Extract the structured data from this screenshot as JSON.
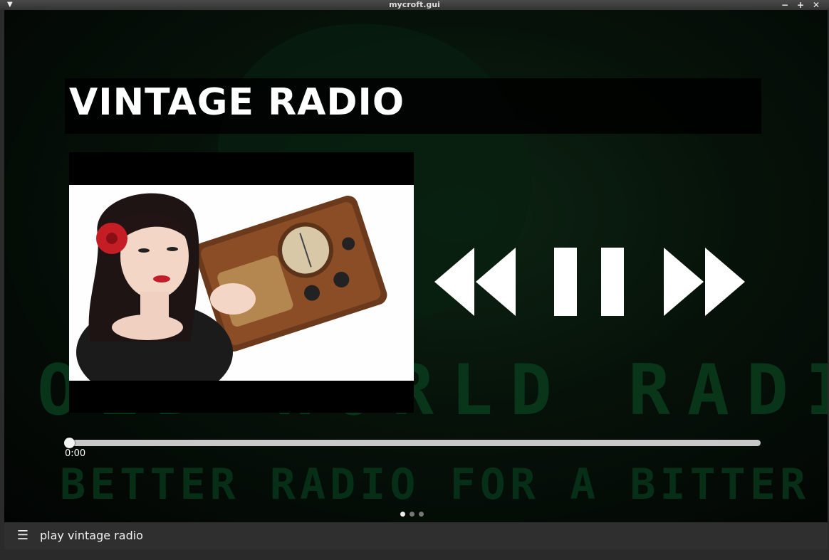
{
  "window": {
    "title": "mycroft.gui",
    "menu_icon": "chevron-down-icon",
    "minimize_icon": "minus-icon",
    "maximize_icon": "plus-icon",
    "close_icon": "close-icon"
  },
  "player": {
    "station_title": "VINTAGE RADIO",
    "elapsed": "0:00",
    "progress_fraction": 0.0,
    "controls": {
      "previous_icon": "rewind-icon",
      "pause_icon": "pause-icon",
      "next_icon": "fast-forward-icon"
    }
  },
  "background": {
    "logo_line1": "OLD WORLD RADIO",
    "logo_line2": "BETTER RADIO FOR A BITTER WORLD"
  },
  "pagination": {
    "count": 3,
    "active_index": 0
  },
  "bottom_bar": {
    "menu_icon": "hamburger-icon",
    "utterance": "play vintage radio"
  },
  "colors": {
    "accent": "#ffffff",
    "background_green": "#0a3f1e"
  }
}
